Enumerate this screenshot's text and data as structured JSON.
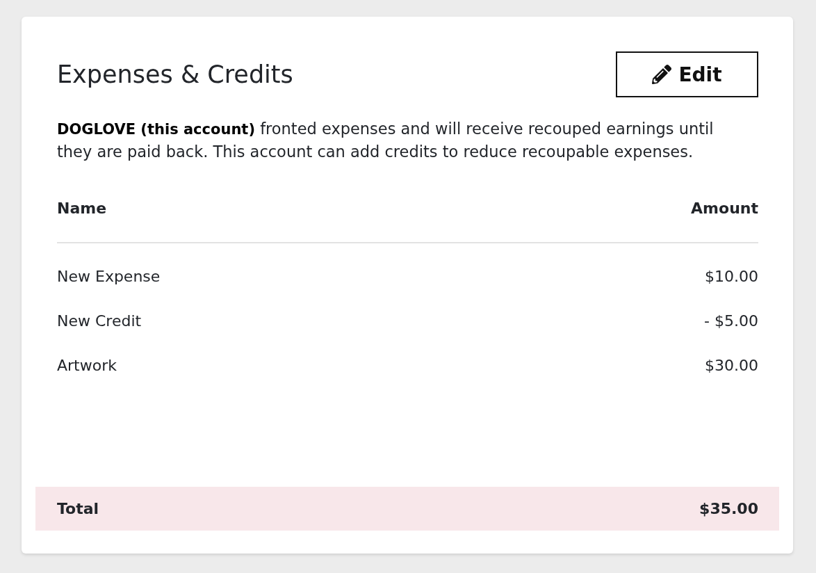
{
  "card": {
    "title": "Expenses & Credits",
    "edit_button": {
      "label": "Edit"
    },
    "description": "**DOGLOVE (this account)** fronted expenses and will receive recouped earnings until they are paid back. This account can add credits to reduce recoupable expenses.",
    "table": {
      "columns": [
        "Name",
        "Amount"
      ],
      "rows": [
        {
          "name": "New Expense",
          "amount": "$10.00"
        },
        {
          "name": "New Credit",
          "amount": "- $5.00"
        },
        {
          "name": "Artwork",
          "amount": "$30.00"
        }
      ]
    },
    "total": {
      "label": "Total",
      "amount": "$35.00"
    }
  }
}
